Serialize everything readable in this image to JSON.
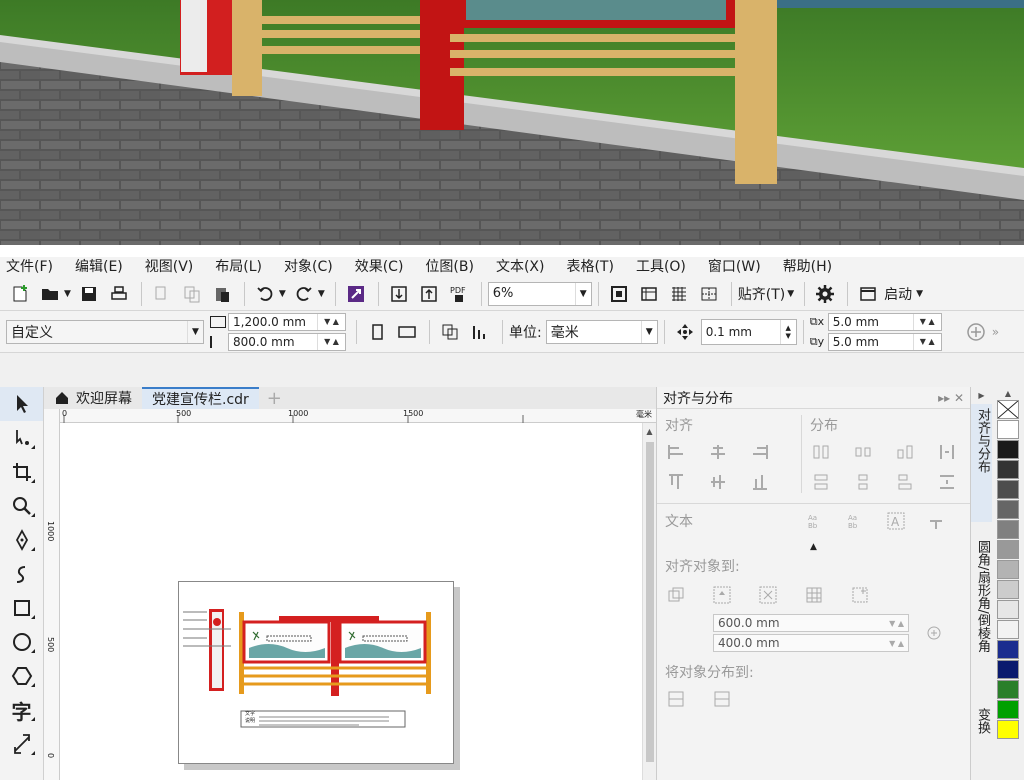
{
  "menu": [
    "文件(F)",
    "编辑(E)",
    "视图(V)",
    "布局(L)",
    "对象(C)",
    "效果(C)",
    "位图(B)",
    "文本(X)",
    "表格(T)",
    "工具(O)",
    "窗口(W)",
    "帮助(H)"
  ],
  "toolbar": {
    "zoom_value": "6%",
    "snap_label": "贴齐(T)",
    "launch_label": "启动"
  },
  "property_bar": {
    "page_preset": "自定义",
    "width": "1,200.0 mm",
    "height": "800.0 mm",
    "unit_label": "单位:",
    "unit_value": "毫米",
    "nudge": "0.1 mm",
    "dup_x": "5.0 mm",
    "dup_y": "5.0 mm"
  },
  "tabs": [
    {
      "label": "欢迎屏幕"
    },
    {
      "label": "党建宣传栏.cdr"
    }
  ],
  "ruler_h": {
    "marks": [
      "0",
      "500",
      "1000",
      "1500"
    ],
    "unit": "毫米"
  },
  "ruler_v": {
    "marks": [
      "1000",
      "500",
      "0"
    ]
  },
  "canvas": {
    "board_text_1": "文字",
    "board_text_2": "说明"
  },
  "panel": {
    "title": "对齐与分布",
    "align_label": "对齐",
    "distribute_label": "分布",
    "text_label": "文本",
    "align_to_label": "对齐对象到:",
    "x_value": "600.0 mm",
    "y_value": "400.0 mm",
    "distribute_to_label": "将对象分布到:"
  },
  "vertical_tabs": [
    "对齐与分布",
    "圆角/扇形角/倒棱角",
    "变换"
  ],
  "palette": [
    "#ffffff",
    "#1a1a1a",
    "#333333",
    "#4d4d4d",
    "#666666",
    "#808080",
    "#999999",
    "#b3b3b3",
    "#cccccc",
    "#e6e6e6",
    "#f2f2f2",
    "#1b2d8f",
    "#0a1a6e",
    "#2a7f2a",
    "#00a000",
    "#ffff00"
  ],
  "colors": {
    "accent": "#3a7dc9",
    "brand_red": "#d42020",
    "post_tan": "#d9b36a"
  }
}
